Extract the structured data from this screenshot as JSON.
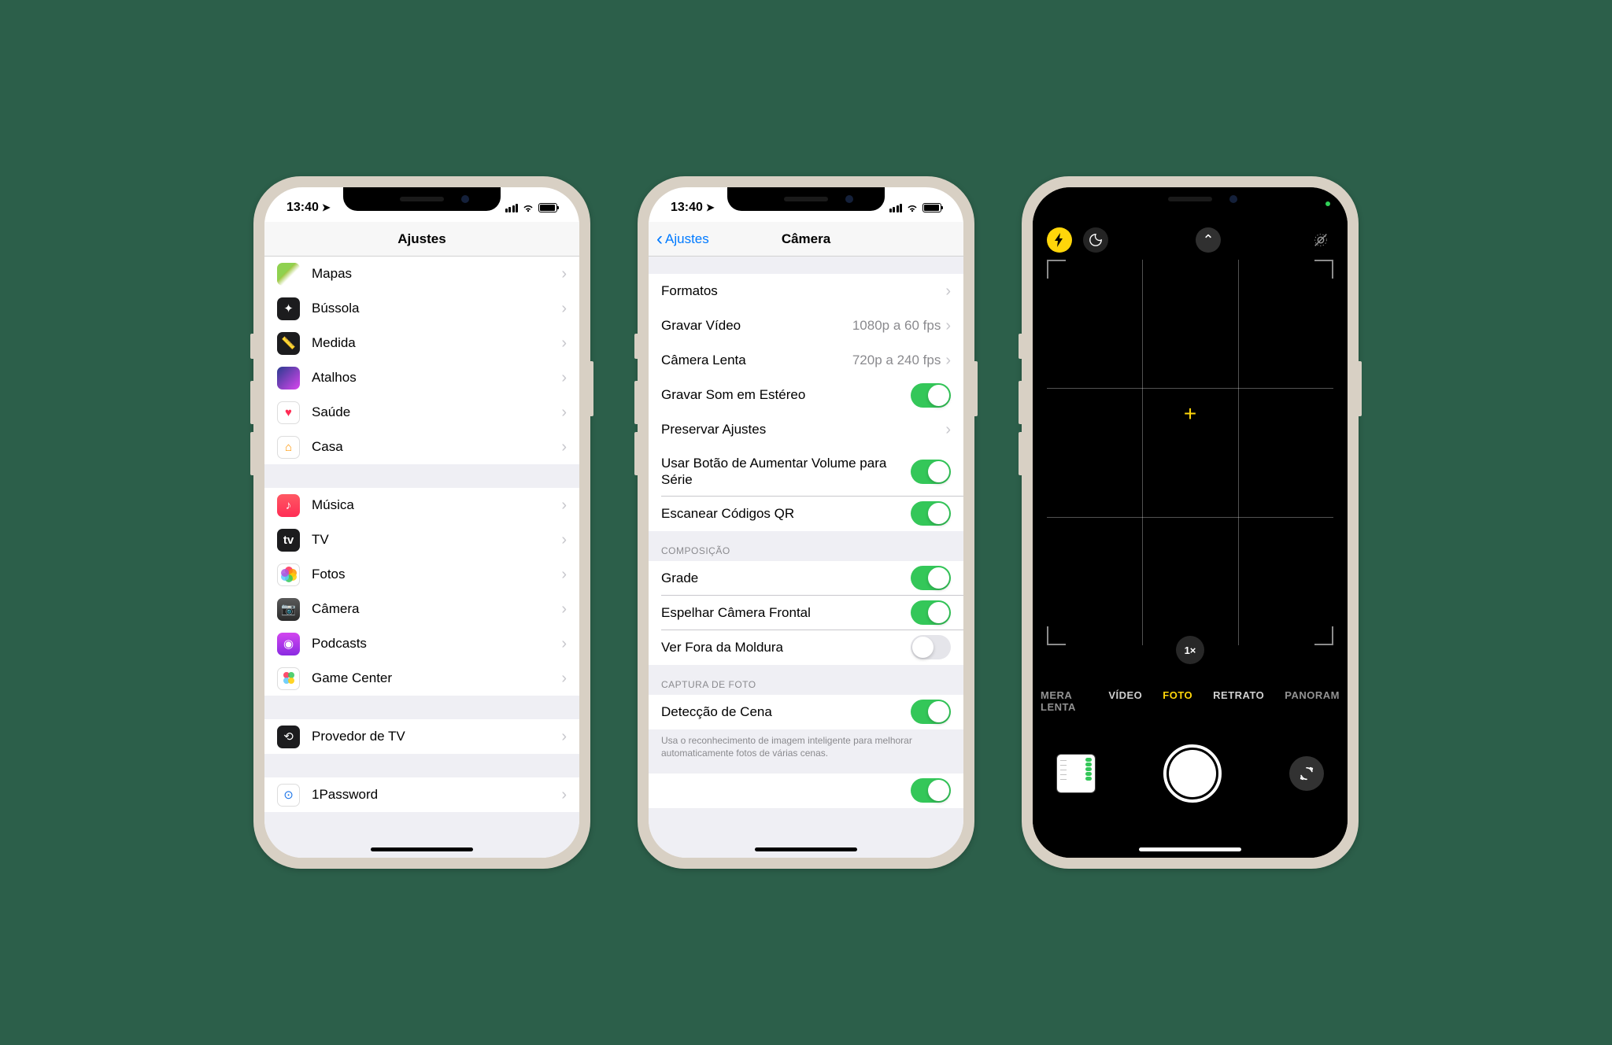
{
  "statusbar": {
    "time": "13:40"
  },
  "phone1": {
    "nav_title": "Ajustes",
    "rows_g1": [
      {
        "icon": "maps-icon",
        "label": "Mapas"
      },
      {
        "icon": "compass-icon",
        "label": "Bússola"
      },
      {
        "icon": "measure-icon",
        "label": "Medida"
      },
      {
        "icon": "shortcuts-icon",
        "label": "Atalhos"
      },
      {
        "icon": "health-icon",
        "label": "Saúde"
      },
      {
        "icon": "home-icon",
        "label": "Casa"
      }
    ],
    "rows_g2": [
      {
        "icon": "music-icon",
        "label": "Música"
      },
      {
        "icon": "tv-icon",
        "label": "TV"
      },
      {
        "icon": "photos-icon",
        "label": "Fotos"
      },
      {
        "icon": "camera-icon",
        "label": "Câmera"
      },
      {
        "icon": "podcasts-icon",
        "label": "Podcasts"
      },
      {
        "icon": "gamecenter-icon",
        "label": "Game Center"
      }
    ],
    "rows_g3": [
      {
        "icon": "tvprovider-icon",
        "label": "Provedor de TV"
      }
    ],
    "rows_g4": [
      {
        "icon": "onepassword-icon",
        "label": "1Password"
      }
    ]
  },
  "phone2": {
    "nav_title": "Câmera",
    "nav_back": "Ajustes",
    "rows_main": [
      {
        "label": "Formatos",
        "type": "nav"
      },
      {
        "label": "Gravar Vídeo",
        "type": "nav",
        "value": "1080p a 60 fps"
      },
      {
        "label": "Câmera Lenta",
        "type": "nav",
        "value": "720p a 240 fps"
      },
      {
        "label": "Gravar Som em Estéreo",
        "type": "toggle",
        "on": true
      },
      {
        "label": "Preservar Ajustes",
        "type": "nav"
      },
      {
        "label": "Usar Botão de Aumentar Volume para Série",
        "type": "toggle",
        "on": true
      },
      {
        "label": "Escanear Códigos QR",
        "type": "toggle",
        "on": true
      }
    ],
    "sec_comp_header": "COMPOSIÇÃO",
    "rows_comp": [
      {
        "label": "Grade",
        "type": "toggle",
        "on": true
      },
      {
        "label": "Espelhar Câmera Frontal",
        "type": "toggle",
        "on": true
      },
      {
        "label": "Ver Fora da Moldura",
        "type": "toggle",
        "on": false
      }
    ],
    "sec_capture_header": "CAPTURA DE FOTO",
    "rows_capture": [
      {
        "label": "Detecção de Cena",
        "type": "toggle",
        "on": true
      }
    ],
    "capture_footer": "Usa o reconhecimento de imagem inteligente para melhorar automaticamente fotos de várias cenas."
  },
  "phone3": {
    "zoom_label": "1×",
    "modes": {
      "clip_left": "MERA LENTA",
      "video": "VÍDEO",
      "foto": "FOTO",
      "retrato": "RETRATO",
      "clip_right": "PANORAM"
    }
  }
}
